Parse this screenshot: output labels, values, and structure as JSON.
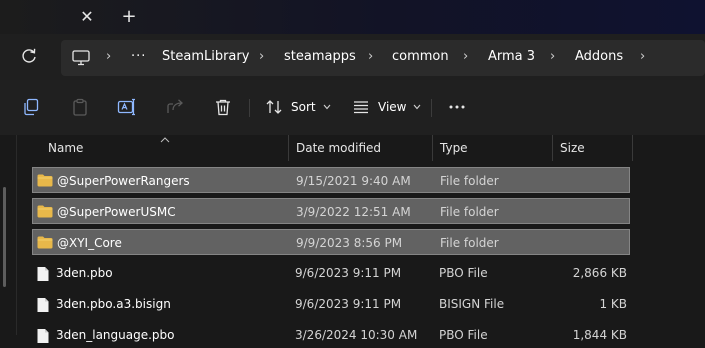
{
  "toolbar": {
    "sort_label": "Sort",
    "view_label": "View"
  },
  "breadcrumb": {
    "overflow": "···",
    "items": [
      "SteamLibrary",
      "steamapps",
      "common",
      "Arma 3",
      "Addons"
    ]
  },
  "columns": {
    "name": "Name",
    "date": "Date modified",
    "type": "Type",
    "size": "Size"
  },
  "files": [
    {
      "name": "@SuperPowerRangers",
      "date": "9/15/2021 9:40 AM",
      "type": "File folder",
      "size": "",
      "kind": "folder",
      "selected": true
    },
    {
      "name": "@SuperPowerUSMC",
      "date": "3/9/2022 12:51 AM",
      "type": "File folder",
      "size": "",
      "kind": "folder",
      "selected": true
    },
    {
      "name": "@XYI_Core",
      "date": "9/9/2023 8:56 PM",
      "type": "File folder",
      "size": "",
      "kind": "folder",
      "selected": true
    },
    {
      "name": "3den.pbo",
      "date": "9/6/2023 9:11 PM",
      "type": "PBO File",
      "size": "2,866 KB",
      "kind": "file",
      "selected": false
    },
    {
      "name": "3den.pbo.a3.bisign",
      "date": "9/6/2023 9:11 PM",
      "type": "BISIGN File",
      "size": "1 KB",
      "kind": "file",
      "selected": false
    },
    {
      "name": "3den_language.pbo",
      "date": "3/26/2024 10:30 AM",
      "type": "PBO File",
      "size": "1,844 KB",
      "kind": "file",
      "selected": false
    }
  ],
  "colors": {
    "folder": "#e8b84a",
    "selection": "#626262"
  }
}
